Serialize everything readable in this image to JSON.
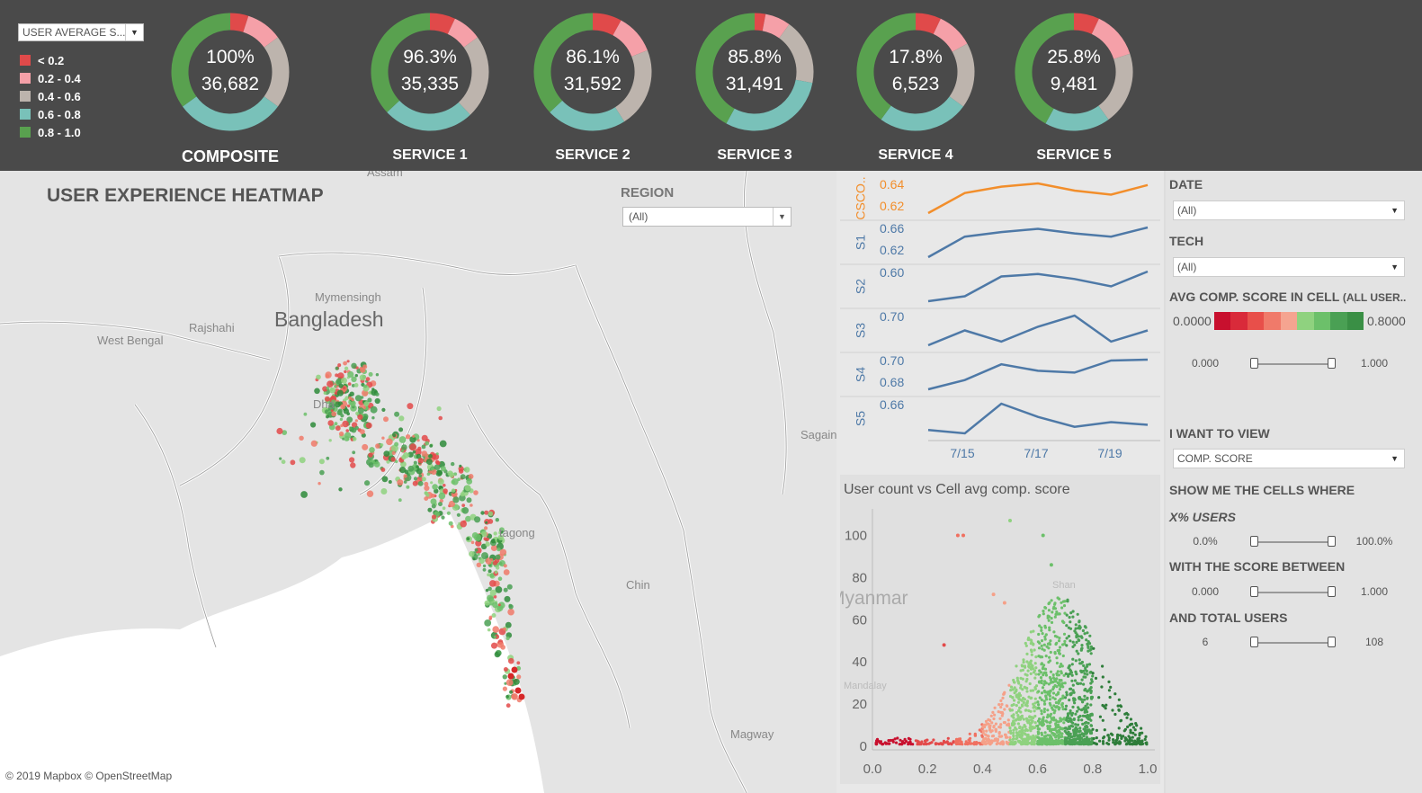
{
  "banner": {
    "color_select": "USER AVERAGE S...",
    "legend": [
      {
        "label": "< 0.2",
        "color": "#e04a4a"
      },
      {
        "label": "0.2 - 0.4",
        "color": "#f5a0a8"
      },
      {
        "label": "0.4 - 0.6",
        "color": "#bdb4ad"
      },
      {
        "label": "0.6 - 0.8",
        "color": "#79c1b9"
      },
      {
        "label": "0.8 - 1.0",
        "color": "#59a14f"
      }
    ],
    "donuts": [
      {
        "label": "COMPOSITE",
        "pct": "100%",
        "count": "36,682",
        "shares": [
          0.05,
          0.1,
          0.2,
          0.3,
          0.35
        ]
      },
      {
        "label": "SERVICE 1",
        "pct": "96.3%",
        "count": "35,335",
        "shares": [
          0.07,
          0.08,
          0.23,
          0.25,
          0.37
        ]
      },
      {
        "label": "SERVICE 2",
        "pct": "86.1%",
        "count": "31,592",
        "shares": [
          0.08,
          0.11,
          0.22,
          0.22,
          0.37
        ]
      },
      {
        "label": "SERVICE 3",
        "pct": "85.8%",
        "count": "31,491",
        "shares": [
          0.03,
          0.07,
          0.18,
          0.3,
          0.42
        ]
      },
      {
        "label": "SERVICE 4",
        "pct": "17.8%",
        "count": "6,523",
        "shares": [
          0.07,
          0.1,
          0.18,
          0.25,
          0.4
        ]
      },
      {
        "label": "SERVICE 5",
        "pct": "25.8%",
        "count": "9,481",
        "shares": [
          0.07,
          0.13,
          0.2,
          0.18,
          0.42
        ]
      }
    ]
  },
  "map": {
    "title": "USER EXPERIENCE HEATMAP",
    "region_label": "REGION",
    "region_value": "(All)",
    "attribution": "© 2019 Mapbox © OpenStreetMap",
    "places": {
      "bangladesh": "Bangladesh",
      "mymensingh": "Mymensingh",
      "rajshahi": "Rajshahi",
      "west_bengal": "West Bengal",
      "assam": "Assam",
      "dhaka": "Dha",
      "chittagong": "tagong",
      "chin": "Chin",
      "sagaing": "Sagain",
      "myanmar": "Myanmar",
      "magway": "Magway",
      "mandalay": "Mandalay",
      "shan": "Shan"
    }
  },
  "sparklines": {
    "x_ticks": [
      "7/15",
      "7/17",
      "7/19"
    ],
    "rows": [
      {
        "name": "CSCO..",
        "color": "#f28e2b",
        "ticks": [
          "0.64",
          "0.62"
        ],
        "values": [
          0.61,
          0.635,
          0.643,
          0.647,
          0.638,
          0.633,
          0.645
        ]
      },
      {
        "name": "S1",
        "color": "#4e79a7",
        "ticks": [
          "0.66",
          "0.62"
        ],
        "values": [
          0.61,
          0.655,
          0.665,
          0.672,
          0.662,
          0.655,
          0.675
        ]
      },
      {
        "name": "S2",
        "color": "#4e79a7",
        "ticks": [
          "0.60"
        ],
        "values": [
          0.57,
          0.58,
          0.62,
          0.625,
          0.615,
          0.6,
          0.63
        ]
      },
      {
        "name": "S3",
        "color": "#4e79a7",
        "ticks": [
          "0.70"
        ],
        "values": [
          0.68,
          0.7,
          0.685,
          0.705,
          0.72,
          0.685,
          0.7
        ]
      },
      {
        "name": "S4",
        "color": "#4e79a7",
        "ticks": [
          "0.70",
          "0.68"
        ],
        "values": [
          0.67,
          0.68,
          0.697,
          0.69,
          0.688,
          0.701,
          0.702
        ]
      },
      {
        "name": "S5",
        "color": "#4e79a7",
        "ticks": [
          "0.66"
        ],
        "values": [
          0.64,
          0.635,
          0.68,
          0.66,
          0.645,
          0.652,
          0.648
        ]
      }
    ]
  },
  "chart_data": {
    "type": "scatter",
    "title": "User count vs Cell avg comp. score",
    "xlim": [
      0,
      1.0
    ],
    "ylim": [
      0,
      110
    ],
    "x_ticks": [
      "0.0",
      "0.2",
      "0.4",
      "0.6",
      "0.8",
      "1.0"
    ],
    "y_ticks": [
      "0",
      "20",
      "40",
      "60",
      "80",
      "100"
    ],
    "bands": [
      {
        "x": [
          0.0,
          0.15
        ],
        "color": "#c8102e"
      },
      {
        "x": [
          0.15,
          0.3
        ],
        "color": "#e34a4a"
      },
      {
        "x": [
          0.3,
          0.4
        ],
        "color": "#f07060"
      },
      {
        "x": [
          0.4,
          0.5
        ],
        "color": "#f5a088"
      },
      {
        "x": [
          0.5,
          0.6
        ],
        "color": "#8fd27f"
      },
      {
        "x": [
          0.6,
          0.7
        ],
        "color": "#6cc06a"
      },
      {
        "x": [
          0.7,
          0.8
        ],
        "color": "#4aa054"
      },
      {
        "x": [
          0.8,
          1.0
        ],
        "color": "#2e7d3a"
      }
    ],
    "outliers": [
      [
        0.31,
        100
      ],
      [
        0.33,
        100
      ],
      [
        0.5,
        107
      ],
      [
        0.62,
        100
      ],
      [
        0.65,
        86
      ],
      [
        0.48,
        68
      ],
      [
        0.44,
        72
      ],
      [
        0.26,
        48
      ]
    ]
  },
  "filters": {
    "date_label": "DATE",
    "date_value": "(All)",
    "tech_label": "TECH",
    "tech_value": "(All)",
    "avg_label": "AVG COMP. SCORE IN CELL",
    "avg_sub": "(ALL USER..",
    "avg_min": "0.0000",
    "avg_max": "0.8000",
    "grad_colors": [
      "#c8102e",
      "#d92a3a",
      "#e84f4a",
      "#f07a6a",
      "#f5a490",
      "#8fd27f",
      "#6cc06a",
      "#4aa054",
      "#3a8f45"
    ],
    "avg_slider": {
      "lo": "0.000",
      "hi": "1.000"
    },
    "view_label": "I WANT TO VIEW",
    "view_value": "COMP. SCORE",
    "show_label": "SHOW ME THE CELLS WHERE",
    "pct_users_label": "X% USERS",
    "pct_slider": {
      "lo": "0.0%",
      "hi": "100.0%"
    },
    "between_label": "WITH THE SCORE BETWEEN",
    "between_slider": {
      "lo": "0.000",
      "hi": "1.000"
    },
    "total_label": "AND TOTAL USERS",
    "total_slider": {
      "lo": "6",
      "hi": "108"
    }
  }
}
